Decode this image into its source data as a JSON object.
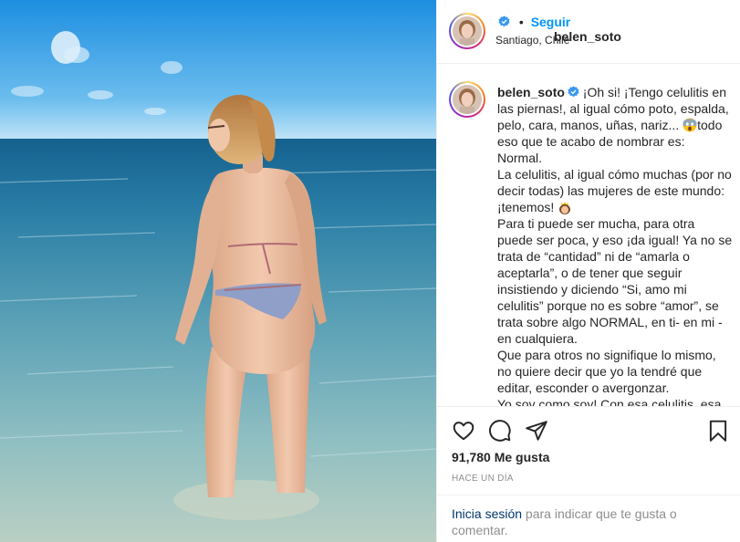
{
  "post": {
    "photo": {
      "subject": "woman in patterned bikini standing in shallow sea water, back to camera",
      "colors": {
        "sky_top": "#1e8fe0",
        "sky_bottom": "#bfe3f7",
        "sea_far": "#1a6d9c",
        "sea_near": "#9cc6c6",
        "sand": "#c9c0a6"
      }
    },
    "header": {
      "username": "belen_soto",
      "verified_icon": "verified-badge-icon",
      "separator": "•",
      "follow_label": "Seguir",
      "location": "Santiago, Chile"
    },
    "caption": {
      "username": "belen_soto",
      "paragraphs": [
        "¡Oh si! ¡Tengo celulitis en las piernas!, al igual cómo poto, espalda, pelo, cara, manos, uñas, nariz...",
        "todo eso que te acabo de nombrar es: Normal.",
        "La celulitis, al igual cómo muchas (por no decir todas) las mujeres de este mundo: ¡tenemos!",
        "Para ti puede ser mucha, para otra puede ser poca, y eso ¡da igual! Ya no se trata de “cantidad” ni de “amarla o aceptarla”, o de tener que seguir insistiendo y diciendo “Si, amo mi celulitis” porque no es sobre “amor”, se trata sobre algo NORMAL, en ti- en mi - en cualquiera.",
        "Que para otros no signifique lo mismo, no quiere decir que yo la tendré que editar, esconder o avergonzar.",
        "Yo soy como soy! Con esa celulitis, esa"
      ],
      "emojis": [
        "screaming-face-emoji",
        "crowned-woman-emoji"
      ]
    },
    "actions": {
      "like_icon": "heart-icon",
      "comment_icon": "comment-icon",
      "share_icon": "share-icon",
      "save_icon": "bookmark-icon"
    },
    "likes": "91,780 Me gusta",
    "timestamp": "HACE UN DÍA",
    "login": {
      "link_label": "Inicia sesión",
      "rest": " para indicar que te gusta o comentar."
    },
    "accent_colors": {
      "link_blue": "#0095f6",
      "login_blue": "#00376b",
      "muted": "#8e8e8e",
      "text": "#262626",
      "verified": "#3897f0"
    }
  }
}
